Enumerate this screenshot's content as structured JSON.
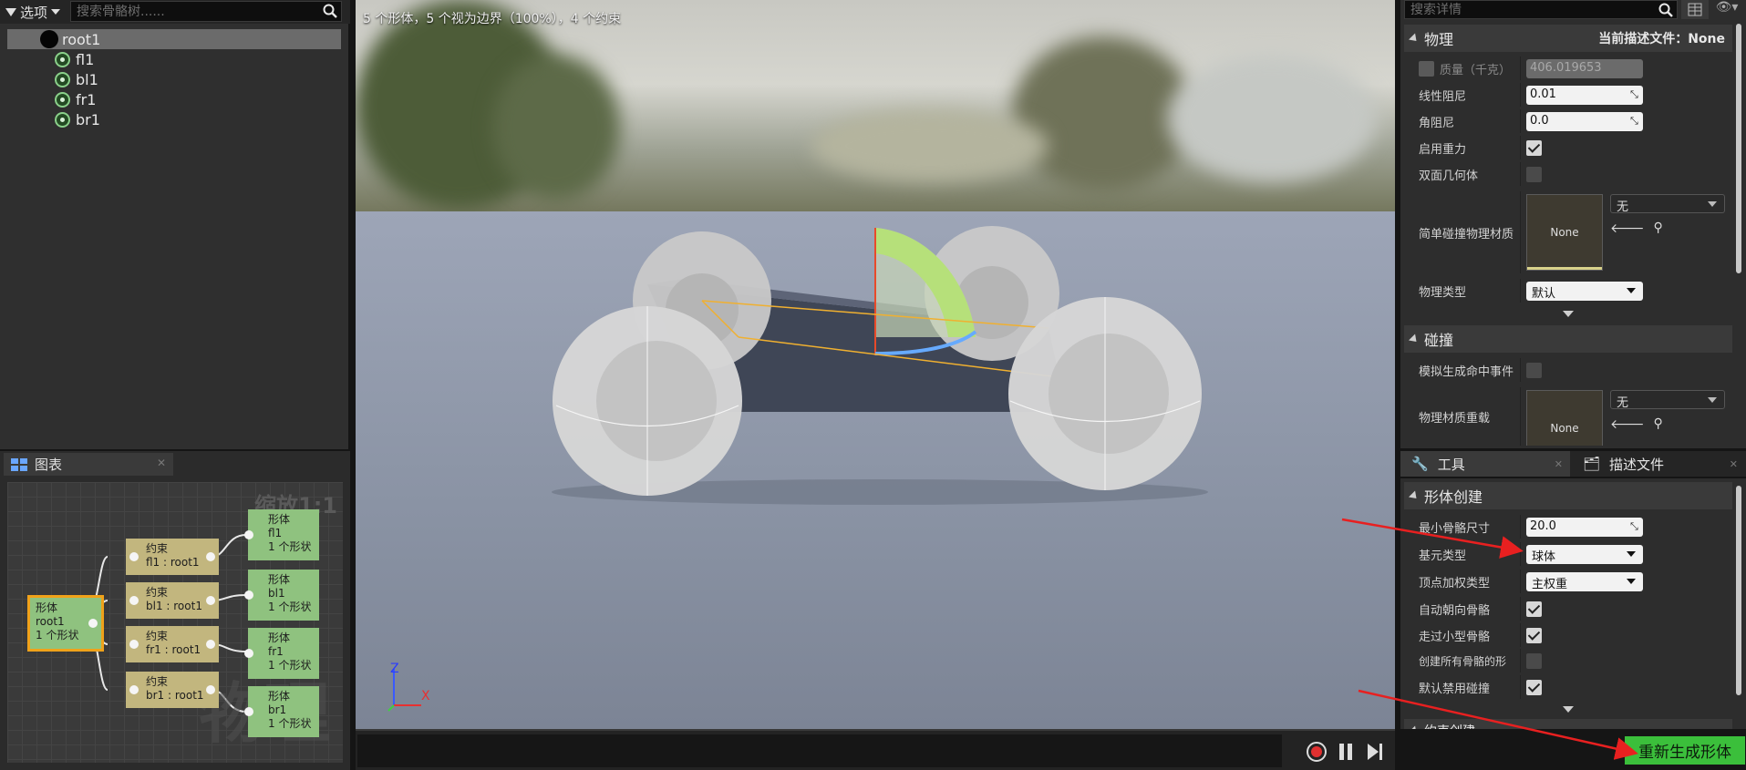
{
  "skeleton_tree": {
    "options_label": "选项",
    "search_placeholder": "搜索骨骼树......",
    "items": [
      {
        "label": "root1",
        "type": "root"
      },
      {
        "label": "fl1",
        "type": "bone"
      },
      {
        "label": "bl1",
        "type": "bone"
      },
      {
        "label": "fr1",
        "type": "bone"
      },
      {
        "label": "br1",
        "type": "bone"
      }
    ]
  },
  "graph": {
    "tab_label": "图表",
    "zoom_label": "缩放1:1",
    "watermark": "物理",
    "root_node": {
      "l1": "形体",
      "l2": "root1",
      "l3": "1 个形状"
    },
    "constraints": [
      {
        "l1": "约束",
        "l2": "fl1 : root1"
      },
      {
        "l1": "约束",
        "l2": "bl1 : root1"
      },
      {
        "l1": "约束",
        "l2": "fr1 : root1"
      },
      {
        "l1": "约束",
        "l2": "br1 : root1"
      }
    ],
    "bodies": [
      {
        "l1": "形体",
        "l2": "fl1",
        "l3": "1 个形状"
      },
      {
        "l1": "形体",
        "l2": "bl1",
        "l3": "1 个形状"
      },
      {
        "l1": "形体",
        "l2": "fr1",
        "l3": "1 个形状"
      },
      {
        "l1": "形体",
        "l2": "br1",
        "l3": "1 个形状"
      }
    ]
  },
  "viewport": {
    "stats": "5 个形体，5 个视为边界（100%），4 个约束",
    "axis_z": "Z",
    "axis_x": "X"
  },
  "details": {
    "search_placeholder": "搜索详情",
    "physics": {
      "title": "物理",
      "current_profile": "当前描述文件：None",
      "mass_label": "质量（千克）",
      "mass_value": "406.019653",
      "linear_damping_label": "线性阻尼",
      "linear_damping_value": "0.01",
      "angular_damping_label": "角阻尼",
      "angular_damping_value": "0.0",
      "enable_gravity_label": "启用重力",
      "double_sided_label": "双面几何体",
      "simple_material_label": "简单碰撞物理材质",
      "material_thumb": "None",
      "material_combo": "无",
      "physics_type_label": "物理类型",
      "physics_type_value": "默认"
    },
    "collision": {
      "title": "碰撞",
      "sim_hit_label": "模拟生成命中事件",
      "material_override_label": "物理材质重载",
      "material_thumb": "None",
      "material_combo": "无"
    }
  },
  "tools": {
    "tab_tools": "工具",
    "tab_profile": "描述文件",
    "section_title": "形体创建",
    "min_bone_size_label": "最小骨骼尺寸",
    "min_bone_size_value": "20.0",
    "primitive_type_label": "基元类型",
    "primitive_type_value": "球体",
    "vertex_weight_label": "顶点加权类型",
    "vertex_weight_value": "主权重",
    "auto_orient_label": "自动朝向骨骼",
    "walk_small_label": "走过小型骨骼",
    "create_all_label": "创建所有骨骼的形",
    "disable_collision_label": "默认禁用碰撞",
    "next_section": "约束创建",
    "regenerate_label": "重新生成形体"
  },
  "colors": {
    "accent_green": "#3bbf3b",
    "annotation_red": "#e82020",
    "selection_orange": "#f0a21a"
  }
}
